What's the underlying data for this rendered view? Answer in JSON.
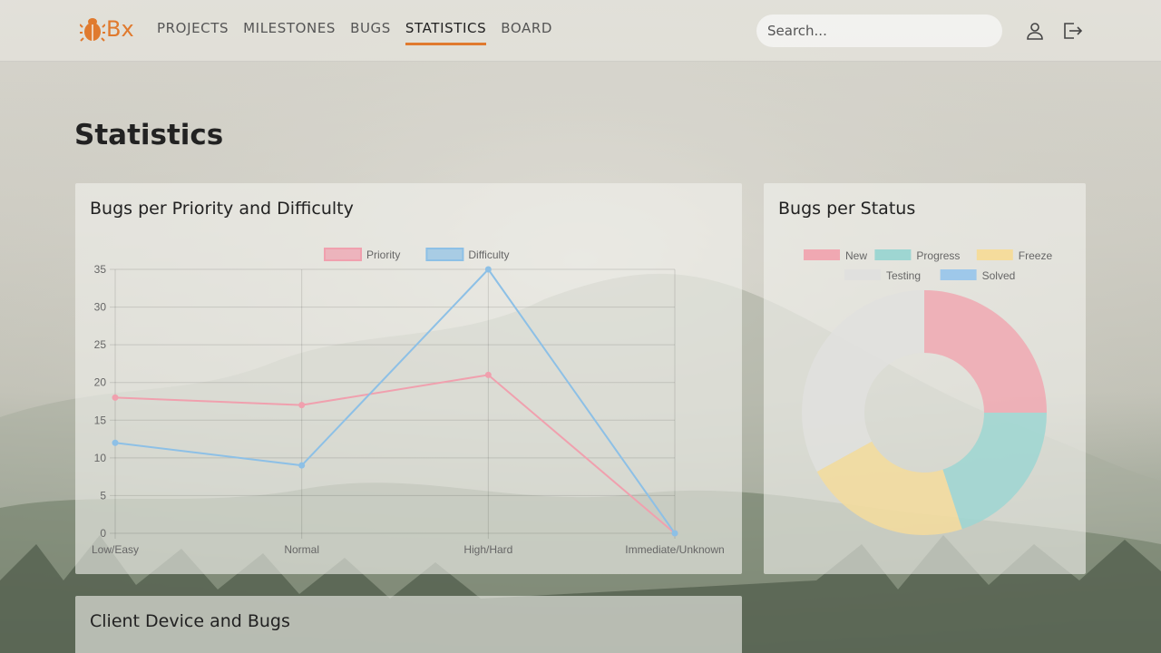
{
  "brand": {
    "name": "Bx",
    "color": "#e07a2e"
  },
  "nav": {
    "items": [
      {
        "label": "PROJECTS"
      },
      {
        "label": "MILESTONES"
      },
      {
        "label": "BUGS"
      },
      {
        "label": "STATISTICS",
        "active": true
      },
      {
        "label": "BOARD"
      }
    ]
  },
  "search": {
    "placeholder": "Search..."
  },
  "header_icons": [
    "user-icon",
    "logout-icon"
  ],
  "page": {
    "title": "Statistics"
  },
  "cards": {
    "priority": {
      "title": "Bugs per Priority and Difficulty"
    },
    "status": {
      "title": "Bugs per Status"
    },
    "device": {
      "title": "Client Device and Bugs"
    }
  },
  "chart_data": [
    {
      "type": "line",
      "categories": [
        "Low/Easy",
        "Normal",
        "High/Hard",
        "Immediate/Unknown"
      ],
      "series": [
        {
          "name": "Priority",
          "values": [
            18,
            17,
            21,
            0
          ],
          "color": "#f0a0ae"
        },
        {
          "name": "Difficulty",
          "values": [
            12,
            9,
            35,
            0
          ],
          "color": "#8dc0e6"
        }
      ],
      "ylim": [
        0,
        35
      ],
      "yticks": [
        0,
        5,
        10,
        15,
        20,
        25,
        30,
        35
      ],
      "grid": true,
      "legend": "top"
    },
    {
      "type": "pie",
      "labels": [
        "New",
        "Progress",
        "Freeze",
        "Testing",
        "Solved"
      ],
      "values": [
        25,
        20,
        22,
        33,
        0
      ],
      "colors": [
        "#f0a8b2",
        "#9ed6d2",
        "#f5dc9c",
        "#e0e0de",
        "#9ec8ea"
      ],
      "legend": "top"
    }
  ]
}
